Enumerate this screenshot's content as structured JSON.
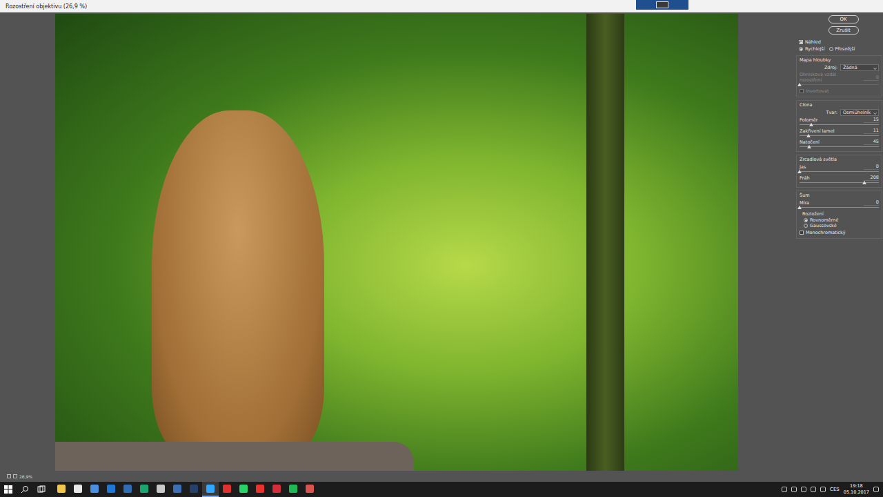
{
  "window": {
    "title": "Rozostření objektivu (26,9 %)"
  },
  "buttons": [
    {
      "label": "OK"
    },
    {
      "label": "Zrušit"
    }
  ],
  "panel": [
    {
      "kind": "checkbox",
      "label": "Náhled",
      "checked": true,
      "disabled": false
    },
    {
      "kind": "radios",
      "options": [
        {
          "label": "Rychlejší",
          "selected": true
        },
        {
          "label": "Přesnější",
          "selected": false
        }
      ]
    },
    {
      "kind": "group",
      "title": "Mapa hloubky",
      "items": [
        {
          "kind": "select",
          "label": "Zdroj:",
          "value": "Žádná",
          "disabled": false
        },
        {
          "kind": "slider",
          "label": "Ohnisková vzdál. rozostření",
          "value": "0",
          "level": 0,
          "disabled": true
        },
        {
          "kind": "checkbox",
          "label": "Invertovat",
          "checked": false,
          "disabled": true
        }
      ]
    },
    {
      "kind": "group",
      "title": "Clona",
      "items": [
        {
          "kind": "select",
          "label": "Tvar:",
          "value": "Osmiúhelník",
          "disabled": false
        },
        {
          "kind": "slider",
          "label": "Poloměr",
          "value": "15",
          "level": 0.15,
          "disabled": false
        },
        {
          "kind": "slider",
          "label": "Zakřivení lamel",
          "value": "11",
          "level": 0.11,
          "disabled": false
        },
        {
          "kind": "slider",
          "label": "Natočení",
          "value": "45",
          "level": 0.125,
          "disabled": false
        }
      ]
    },
    {
      "kind": "group",
      "title": "Zrcadlová světla",
      "items": [
        {
          "kind": "slider",
          "label": "Jas",
          "value": "0",
          "level": 0,
          "disabled": false
        },
        {
          "kind": "slider",
          "label": "Práh",
          "value": "208",
          "level": 0.82,
          "disabled": false
        }
      ]
    },
    {
      "kind": "group",
      "title": "Šum",
      "items": [
        {
          "kind": "slider",
          "label": "Míra",
          "value": "0",
          "level": 0,
          "disabled": false
        },
        {
          "kind": "label",
          "label": "Rozložení"
        },
        {
          "kind": "radios",
          "vertical": true,
          "options": [
            {
              "label": "Rovnoměrné",
              "selected": true
            },
            {
              "label": "Gaussovské",
              "selected": false
            }
          ]
        },
        {
          "kind": "checkbox",
          "label": "Monochromatický",
          "checked": false,
          "disabled": false
        }
      ]
    }
  ],
  "status_bar": {
    "zoom": "26,9%"
  },
  "taskbar": {
    "apps": [
      {
        "color": "#f2c84b",
        "selected": false
      },
      {
        "color": "#e8e8e8",
        "selected": false
      },
      {
        "color": "#4a8fe0",
        "selected": false
      },
      {
        "color": "#1d78d6",
        "selected": false
      },
      {
        "color": "#2f6db5",
        "selected": false
      },
      {
        "color": "#1aa56f",
        "selected": false
      },
      {
        "color": "#c9c9c9",
        "selected": false
      },
      {
        "color": "#3b6fb6",
        "selected": false
      },
      {
        "color": "#25406b",
        "selected": false
      },
      {
        "color": "#31a8ff",
        "selected": true
      },
      {
        "color": "#e03131",
        "selected": false
      },
      {
        "color": "#25d366",
        "selected": false
      },
      {
        "color": "#e8322e",
        "selected": false
      },
      {
        "color": "#d62d3a",
        "selected": false
      },
      {
        "color": "#1db954",
        "selected": false
      },
      {
        "color": "#d9534f",
        "selected": false
      }
    ],
    "language": "CES",
    "time": "19:18",
    "date": "05.10.2017"
  }
}
